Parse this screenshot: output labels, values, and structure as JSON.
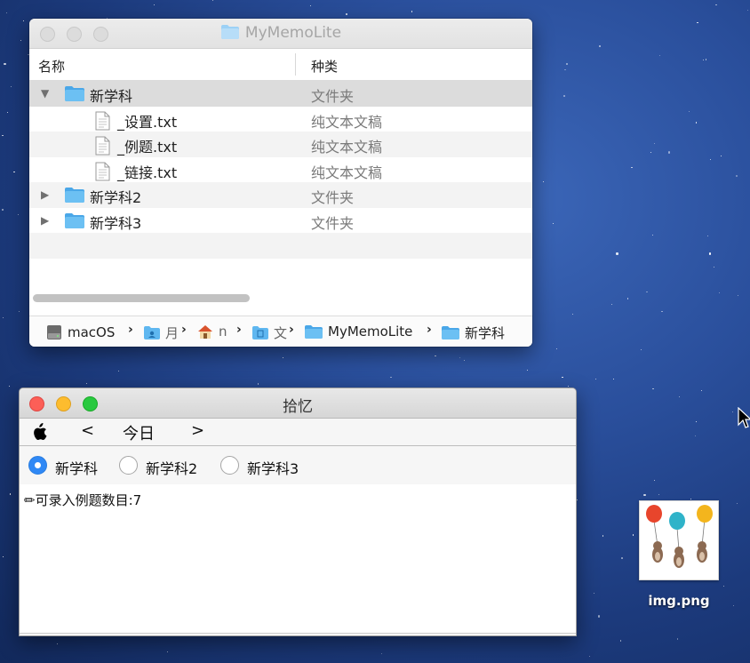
{
  "finder": {
    "title": "MyMemoLite",
    "col_name": "名称",
    "col_kind": "种类",
    "rows": [
      {
        "name": "新学科",
        "kind": "文件夹",
        "type": "folder",
        "disclosure": "▼",
        "expanded": true,
        "selected": true
      },
      {
        "name": "_设置.txt",
        "kind": "纯文本文稿",
        "type": "doc"
      },
      {
        "name": "_例题.txt",
        "kind": "纯文本文稿",
        "type": "doc"
      },
      {
        "name": "_链接.txt",
        "kind": "纯文本文稿",
        "type": "doc"
      },
      {
        "name": "新学科2",
        "kind": "文件夹",
        "type": "folder",
        "disclosure": "▶"
      },
      {
        "name": "新学科3",
        "kind": "文件夹",
        "type": "folder",
        "disclosure": "▶"
      }
    ],
    "path": [
      {
        "label": "macOS",
        "icon": "disk-icon"
      },
      {
        "label": "月",
        "icon": "user-folder-icon"
      },
      {
        "label": "n",
        "icon": "home-icon"
      },
      {
        "label": "文",
        "icon": "documents-folder-icon"
      },
      {
        "label": "MyMemoLite",
        "icon": "folder-icon"
      },
      {
        "label": "新学科",
        "icon": "folder-icon"
      }
    ],
    "path_separator": "›"
  },
  "memo": {
    "title": "拾忆",
    "toolbar": {
      "apple": "",
      "prev": "<",
      "today": "今日",
      "next": ">"
    },
    "subjects": [
      {
        "label": "新学科",
        "selected": true
      },
      {
        "label": "新学科2",
        "selected": false
      },
      {
        "label": "新学科3",
        "selected": false
      }
    ],
    "body_text": "✏可录入例题数目:7"
  },
  "desktop": {
    "file_label": "img.png"
  },
  "colors": {
    "accent": "#2f88f5",
    "folder": "#5fb7f0",
    "close": "#fc5f57",
    "minimize": "#fdbc2e",
    "zoom": "#29c940"
  }
}
